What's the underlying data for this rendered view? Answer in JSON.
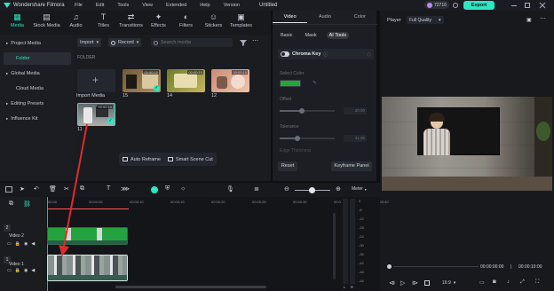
{
  "app": {
    "name": "Wondershare Filmora",
    "menu": [
      "File",
      "Edit",
      "Tools",
      "View",
      "Extended",
      "Help",
      "Version"
    ],
    "doc_title": "Untitled",
    "credits": "72716",
    "export_label": "Export"
  },
  "toolbar": {
    "items": [
      "Media",
      "Stock Media",
      "Audio",
      "Titles",
      "Transitions",
      "Effects",
      "Filters",
      "Stickers",
      "Templates"
    ],
    "active": "Media"
  },
  "sidebar": {
    "items": [
      {
        "label": "Project Media",
        "kind": "header"
      },
      {
        "label": "Folder",
        "kind": "active"
      },
      {
        "label": "Global Media",
        "kind": "header"
      },
      {
        "label": "Cloud Media",
        "kind": "item"
      },
      {
        "label": "Editing Presets",
        "kind": "header"
      },
      {
        "label": "Influence Kit",
        "kind": "header"
      }
    ]
  },
  "media": {
    "import_label": "Import",
    "record_label": "Record",
    "search_placeholder": "Search media",
    "folder_label": "FOLDER",
    "import_media_label": "Import Media",
    "clips": [
      {
        "name": "15",
        "duration": "00:00:10"
      },
      {
        "name": "14",
        "duration": "00:00:10"
      },
      {
        "name": "12",
        "duration": "00:00:10"
      },
      {
        "name": "11",
        "duration": "00:00:10"
      }
    ],
    "auto_reframe_label": "Auto Reframe",
    "smart_scene_cut_label": "Smart Scene Cut"
  },
  "properties": {
    "tabs": [
      "Video",
      "Audio",
      "Color"
    ],
    "active_tab": "Video",
    "subtabs": [
      "Basic",
      "Mask",
      "AI Tools"
    ],
    "active_subtab": "AI Tools",
    "chroma_label": "Chroma Key",
    "select_color_label": "Select Color",
    "key_color": "#1fa83a",
    "offset_label": "Offset",
    "offset_value": "20.00",
    "offset_level": 0.4,
    "tolerance_label": "Tolerance",
    "tolerance_value": "31.00",
    "tolerance_level": 0.33,
    "edge_label": "Edge Thickness",
    "reset_label": "Reset",
    "keyframe_label": "Keyframe Panel"
  },
  "player": {
    "label": "Player",
    "quality": "Full Quality",
    "time_current": "00:00:00:00",
    "time_total": "00:00:10:00",
    "ratio": "16:9"
  },
  "timeline": {
    "meter_label": "Meter",
    "ruler": [
      "00:00",
      "00:00:05",
      "00:00:10",
      "00:00:15",
      "00:00:20",
      "00:00:25",
      "00:00:30",
      "00:00:35",
      "00:00:40"
    ],
    "tracks": [
      {
        "name": "Video 2",
        "num": "2"
      },
      {
        "name": "Video 1",
        "num": "1"
      }
    ],
    "db_scale": [
      "0",
      "-6",
      "-12",
      "-18",
      "-24",
      "-30",
      "-36",
      "-42",
      "-48",
      "-54"
    ],
    "lr": [
      "L",
      "R"
    ]
  },
  "colors": {
    "accent": "#2ee6c2",
    "export": "#2ee6c2",
    "playhead": "#ff5a5a",
    "arrow": "#e02b2b"
  }
}
